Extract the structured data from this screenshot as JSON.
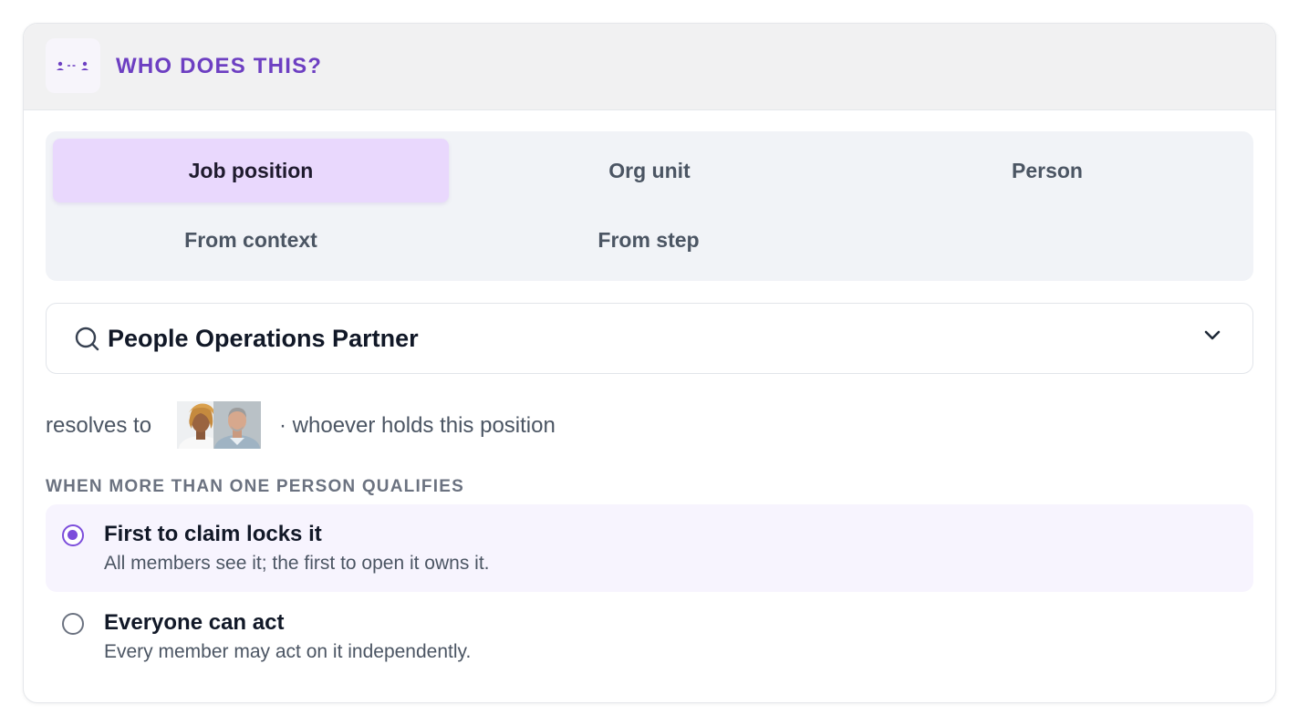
{
  "header": {
    "title": "WHO DOES THIS?",
    "icon": "assignee-flow-icon"
  },
  "tabs": [
    {
      "label": "Job position",
      "active": true
    },
    {
      "label": "Org unit",
      "active": false
    },
    {
      "label": "Person",
      "active": false
    },
    {
      "label": "From context",
      "active": false
    },
    {
      "label": "From step",
      "active": false
    }
  ],
  "position_select": {
    "value": "People Operations Partner",
    "icon": "search-icon"
  },
  "resolves": {
    "label": "resolves to",
    "tail": "· whoever holds this position"
  },
  "strategy": {
    "label": "WHEN MORE THAN ONE PERSON QUALIFIES",
    "options": [
      {
        "title": "First to claim locks it",
        "description": "All members see it; the first to open it owns it.",
        "selected": true
      },
      {
        "title": "Everyone can act",
        "description": "Every member may act on it independently.",
        "selected": false
      }
    ]
  },
  "colors": {
    "accent": "#6d3fc2",
    "tab_active_bg": "#e9d8fd",
    "radio_selected": "#7c4ddb"
  }
}
